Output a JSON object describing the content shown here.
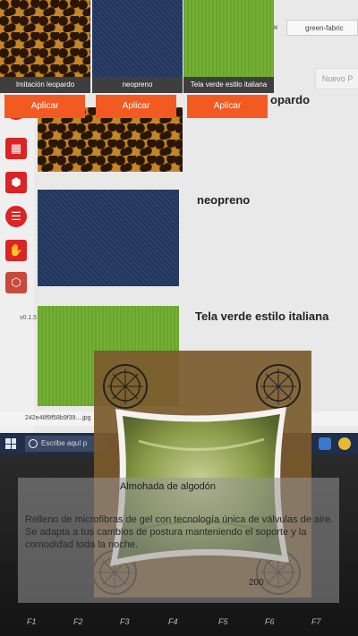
{
  "materials": [
    {
      "label": "Imitación leopardo",
      "button": "Aplicar"
    },
    {
      "label": "neopreno",
      "button": "Aplicar"
    },
    {
      "label": "Tela verde estilo italiana",
      "button": "Aplicar"
    }
  ],
  "background_app": {
    "browser_tab": "green-fabric",
    "top_button": "Nuevo P",
    "version": "v0.1.5",
    "list": [
      {
        "title": "opardo"
      },
      {
        "title": "neopreno"
      },
      {
        "title": "Tela verde estilo italiana"
      }
    ],
    "download_file": "242e48f9f58b9f39....jpg"
  },
  "taskbar": {
    "search_placeholder": "Escribe aquí p"
  },
  "keyboard": {
    "keys": [
      "F1",
      "F2",
      "F3",
      "F4",
      "F5",
      "F6",
      "F7"
    ]
  },
  "product": {
    "name": "Almohada de algodón",
    "description": "Relleno de microfibras de gel con tecnología única de válvulas de aire. Se adapta a tus cambios de postura manteniendo el soporte y la comodidad toda la noche.",
    "price": "200"
  },
  "colors": {
    "accent": "#f25a22",
    "sidebar_icon": "#d92525",
    "panel": "#969696"
  }
}
